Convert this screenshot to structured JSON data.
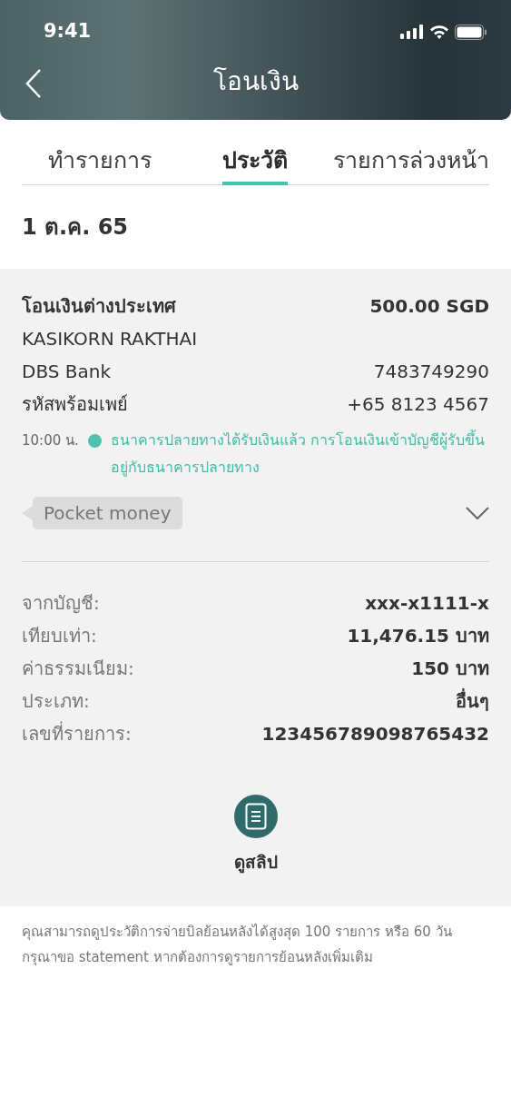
{
  "status_bar": {
    "time": "9:41"
  },
  "header": {
    "title": "โอนเงิน"
  },
  "tabs": [
    {
      "label": "ทำรายการ",
      "selected": false
    },
    {
      "label": "ประวัติ",
      "selected": true
    },
    {
      "label": "รายการล่วงหน้า",
      "selected": false
    }
  ],
  "date": "1 ต.ค. 65",
  "transaction": {
    "title": "โอนเงินต่างประเทศ",
    "amount": "500.00 SGD",
    "recipient": "KASIKORN RAKTHAI",
    "bank": "DBS Bank",
    "account": "7483749290",
    "promptpay_label": "รหัสพร้อมเพย์",
    "promptpay": "+65 8123 4567",
    "time": "10:00 น.",
    "received": true,
    "status": "ธนาคารปลายทางได้รับเงินแล้ว การโอนเงินเข้าบัญชีผู้รับขึ้นอยู่กับธนาคารปลายทาง",
    "note": "Pocket money",
    "expanded": true
  },
  "details": [
    {
      "label": "จากบัญชี:",
      "value": "xxx-x1111-x"
    },
    {
      "label": "เทียบเท่า:",
      "value": "11,476.15 บาท"
    },
    {
      "label": "ค่าธรรมเนียม:",
      "value": "150 บาท"
    },
    {
      "label": "ประเภท:",
      "value": "อื่นๆ"
    },
    {
      "label": "เลขที่รายการ:",
      "value": "123456789098765432"
    }
  ],
  "slip_button": "ดูสลิป",
  "footer_note": "คุณสามารถดูประวัติการจ่ายบิลย้อนหลังได้สูงสุด 100 รายการ หรือ 60 วัน กรุณาขอ statement หากต้องการดูรายการย้อนหลังเพิ่มเติม"
}
